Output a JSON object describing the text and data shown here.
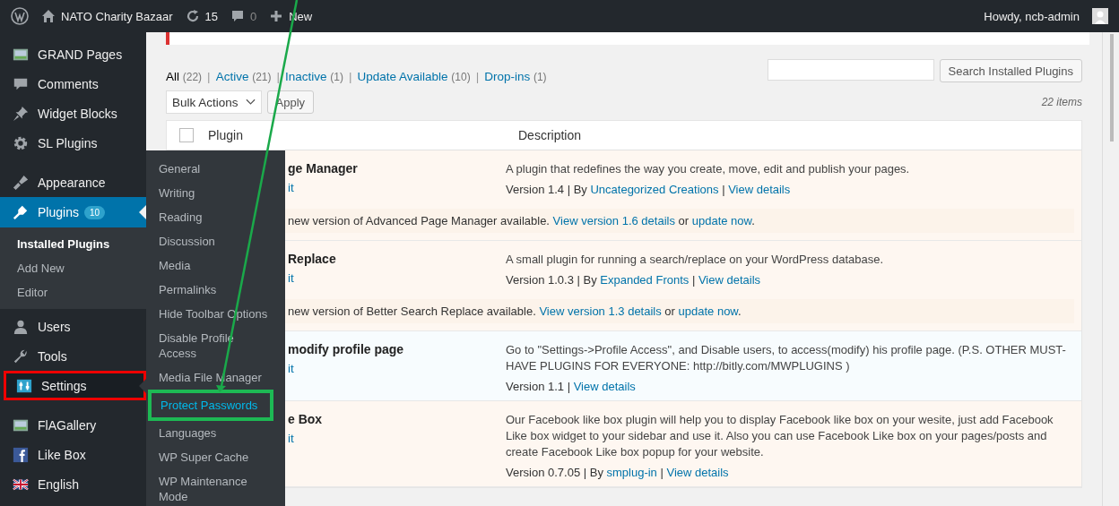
{
  "top_bar": {
    "site": "NATO Charity Bazaar",
    "updates": "15",
    "comments": "0",
    "new": "New",
    "greeting": "Howdy, ncb-admin"
  },
  "sidebar": {
    "items": [
      {
        "kind": "item",
        "label": "GRAND Pages",
        "selected": false,
        "hovered": false
      },
      {
        "kind": "item",
        "label": "Comments",
        "selected": false,
        "hovered": false
      },
      {
        "kind": "item",
        "label": "Widget Blocks",
        "selected": false,
        "hovered": false
      },
      {
        "kind": "item",
        "label": "SL Plugins",
        "selected": false,
        "hovered": false
      },
      {
        "kind": "separator"
      },
      {
        "kind": "item",
        "label": "Appearance",
        "selected": false,
        "hovered": false
      },
      {
        "kind": "item",
        "label": "Plugins",
        "selected": true,
        "hovered": false,
        "badge": "10",
        "children": [
          {
            "label": "Installed Plugins",
            "selected": true
          },
          {
            "label": "Add New",
            "selected": false
          },
          {
            "label": "Editor",
            "selected": false
          }
        ]
      },
      {
        "kind": "item",
        "label": "Users",
        "selected": false,
        "hovered": false
      },
      {
        "kind": "item",
        "label": "Tools",
        "selected": false,
        "hovered": false
      },
      {
        "kind": "item",
        "label": "Settings",
        "selected": false,
        "hovered": true
      },
      {
        "kind": "separator"
      },
      {
        "kind": "item",
        "label": "FlAGallery",
        "selected": false,
        "hovered": false
      },
      {
        "kind": "item",
        "label": "Like Box",
        "selected": false,
        "hovered": false
      },
      {
        "kind": "item",
        "label": "English",
        "selected": false,
        "hovered": false
      }
    ]
  },
  "flyout": {
    "items": [
      {
        "label": "General",
        "selected": false
      },
      {
        "label": "Writing",
        "selected": false
      },
      {
        "label": "Reading",
        "selected": false
      },
      {
        "label": "Discussion",
        "selected": false
      },
      {
        "label": "Media",
        "selected": false
      },
      {
        "label": "Permalinks",
        "selected": false
      },
      {
        "label": "Hide Toolbar Options",
        "selected": false
      },
      {
        "label": "Disable Profile Access",
        "selected": false
      },
      {
        "label": "Media File Manager",
        "selected": false
      },
      {
        "label": "Protect Passwords",
        "selected": true
      },
      {
        "label": "Languages",
        "selected": false
      },
      {
        "label": "WP Super Cache",
        "selected": false
      },
      {
        "label": "WP Maintenance Mode",
        "selected": false
      }
    ]
  },
  "filters": [
    {
      "label": "All",
      "count": "(22)",
      "selected": true
    },
    {
      "separator": "|",
      "label": "Active",
      "count": "(21)",
      "selected": false
    },
    {
      "separator": "|",
      "label": "Inactive",
      "count": "(1)",
      "selected": false
    },
    {
      "separator": "|",
      "label": "Update Available",
      "count": "(10)",
      "selected": false
    },
    {
      "separator": "|",
      "label": "Drop-ins",
      "count": "(1)",
      "selected": false
    }
  ],
  "search": {
    "button": "Search Installed Plugins"
  },
  "bulk": {
    "select": "Bulk Actions",
    "apply": "Apply",
    "count": "22 items"
  },
  "table": {
    "columns": [
      "Plugin",
      "Description"
    ],
    "select_all": {
      "checked": false
    },
    "rows": [
      {
        "update_available": true,
        "name": "ge Manager",
        "action": "it",
        "description": "A plugin that redefines the way you create, move, edit and publish your pages.",
        "meta": [
          {
            "text": "Version 1.4 | By "
          },
          {
            "text": "Uncategorized Creations",
            "link": true
          },
          {
            "text": " | "
          },
          {
            "text": "View details",
            "link": true
          }
        ],
        "update": [
          {
            "text": "new version of Advanced Page Manager available. "
          },
          {
            "text": "View version 1.6 details",
            "link": true
          },
          {
            "text": " or "
          },
          {
            "text": "update now",
            "link": true
          },
          {
            "text": "."
          }
        ]
      },
      {
        "update_available": true,
        "name": "Replace",
        "action": "it",
        "description": "A small plugin for running a search/replace on your WordPress database.",
        "meta": [
          {
            "text": "Version 1.0.3 | By "
          },
          {
            "text": "Expanded Fronts",
            "link": true
          },
          {
            "text": " | "
          },
          {
            "text": "View details",
            "link": true
          }
        ],
        "update": [
          {
            "text": "new version of Better Search Replace available. "
          },
          {
            "text": "View version 1.3 details",
            "link": true
          },
          {
            "text": " or "
          },
          {
            "text": "update now",
            "link": true
          },
          {
            "text": "."
          }
        ]
      },
      {
        "update_available": false,
        "name": "modify profile page",
        "action": "it",
        "description": "Go to \"Settings->Profile Access\", and Disable users, to access(modify) his profile page. (P.S. OTHER MUST-HAVE PLUGINS FOR EVERYONE: http://bitly.com/MWPLUGINS )",
        "meta": [
          {
            "text": "Version 1.1 | "
          },
          {
            "text": "View details",
            "link": true
          }
        ]
      },
      {
        "update_available": true,
        "name": "e Box",
        "action": "it",
        "description": "Our Facebook like box plugin will help you to display Facebook like box on your wesite, just add Facebook Like box widget to your sidebar and use it. Also you can use Facebook Like box on your pages/posts and create Facebook Like box popup for your website.",
        "meta": [
          {
            "text": "Version 0.7.05 | By "
          },
          {
            "text": "smplug-in",
            "link": true
          },
          {
            "text": " | "
          },
          {
            "text": "View details",
            "link": true
          }
        ]
      }
    ]
  }
}
